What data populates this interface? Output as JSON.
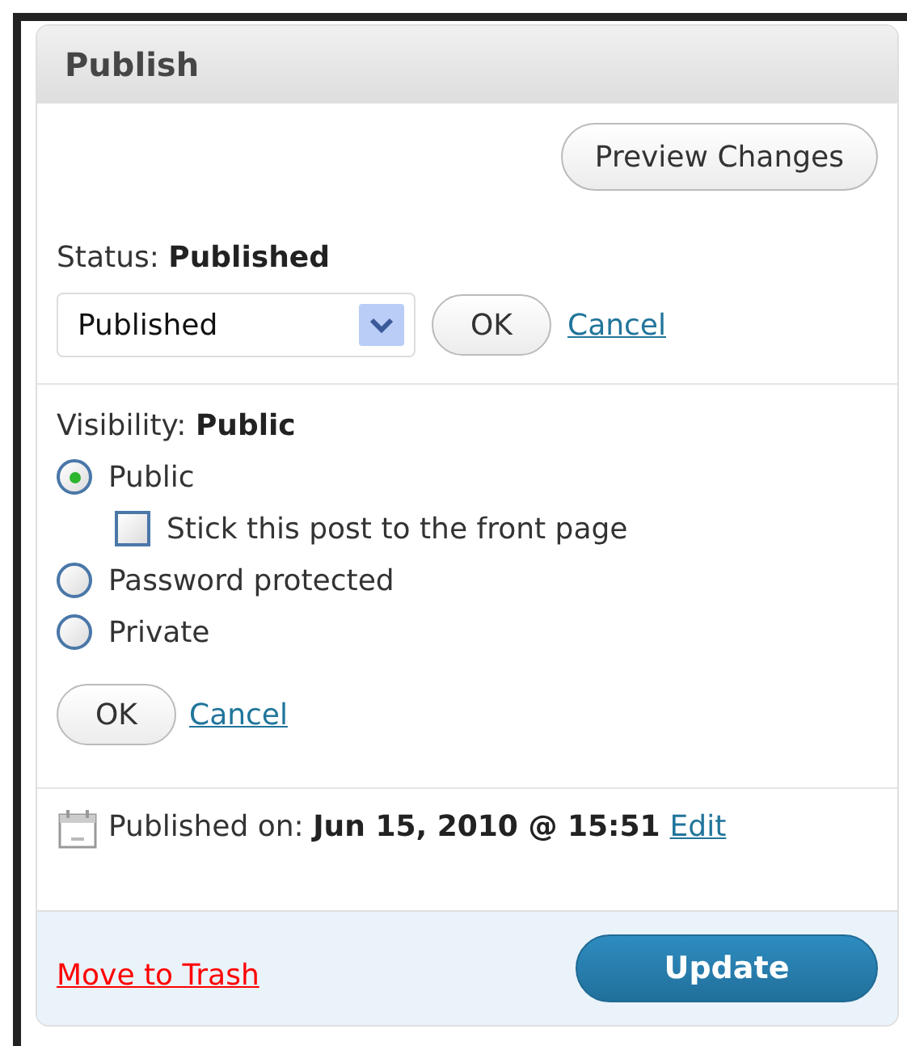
{
  "panel": {
    "title": "Publish"
  },
  "preview_button": "Preview Changes",
  "status": {
    "label": "Status:",
    "value": "Published",
    "select_value": "Published",
    "ok": "OK",
    "cancel": "Cancel"
  },
  "visibility": {
    "label": "Visibility:",
    "value": "Public",
    "options": [
      {
        "kind": "radio",
        "label": "Public",
        "selected": true,
        "children": [
          {
            "kind": "checkbox",
            "label": "Stick this post to the front page",
            "checked": false
          }
        ]
      },
      {
        "kind": "radio",
        "label": "Password protected",
        "selected": false
      },
      {
        "kind": "radio",
        "label": "Private",
        "selected": false
      }
    ],
    "ok": "OK",
    "cancel": "Cancel"
  },
  "published_on": {
    "label": "Published on:",
    "value": "Jun 15, 2010 @ 15:51",
    "edit": "Edit"
  },
  "footer": {
    "trash_link": "Move to Trash",
    "update_button": "Update"
  }
}
